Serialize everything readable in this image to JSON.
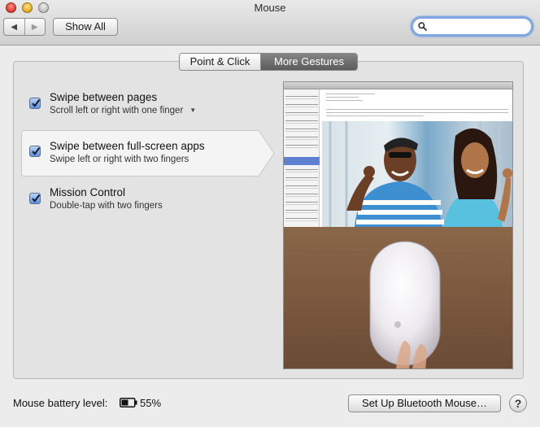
{
  "window": {
    "title": "Mouse"
  },
  "toolbar": {
    "show_all_label": "Show All",
    "search": {
      "value": "",
      "placeholder": ""
    }
  },
  "tabs": [
    {
      "label": "Point & Click",
      "selected": false
    },
    {
      "label": "More Gestures",
      "selected": true
    }
  ],
  "options": [
    {
      "title": "Swipe between pages",
      "subtitle": "Scroll left or right with one finger",
      "checked": true,
      "has_dropdown": true
    },
    {
      "title": "Swipe between full-screen apps",
      "subtitle": "Swipe left or right with two fingers",
      "checked": true,
      "highlighted": true
    },
    {
      "title": "Mission Control",
      "subtitle": "Double-tap with two fingers",
      "checked": true
    }
  ],
  "footer": {
    "battery_label": "Mouse battery level:",
    "battery_level": "55%",
    "battery_fraction": 0.55,
    "bluetooth_button_label": "Set Up Bluetooth Mouse…",
    "help_label": "?"
  },
  "icons": {
    "search": "search-icon",
    "back": "chevron-left-icon",
    "forward": "chevron-right-icon",
    "battery": "battery-icon",
    "checkbox": "checkmark-icon",
    "dropdown": "triangle-down-icon"
  },
  "colors": {
    "selected_tab": "#6f6f6f",
    "checkbox": "#5f8fd8",
    "search_focus": "#7fa8e3"
  }
}
